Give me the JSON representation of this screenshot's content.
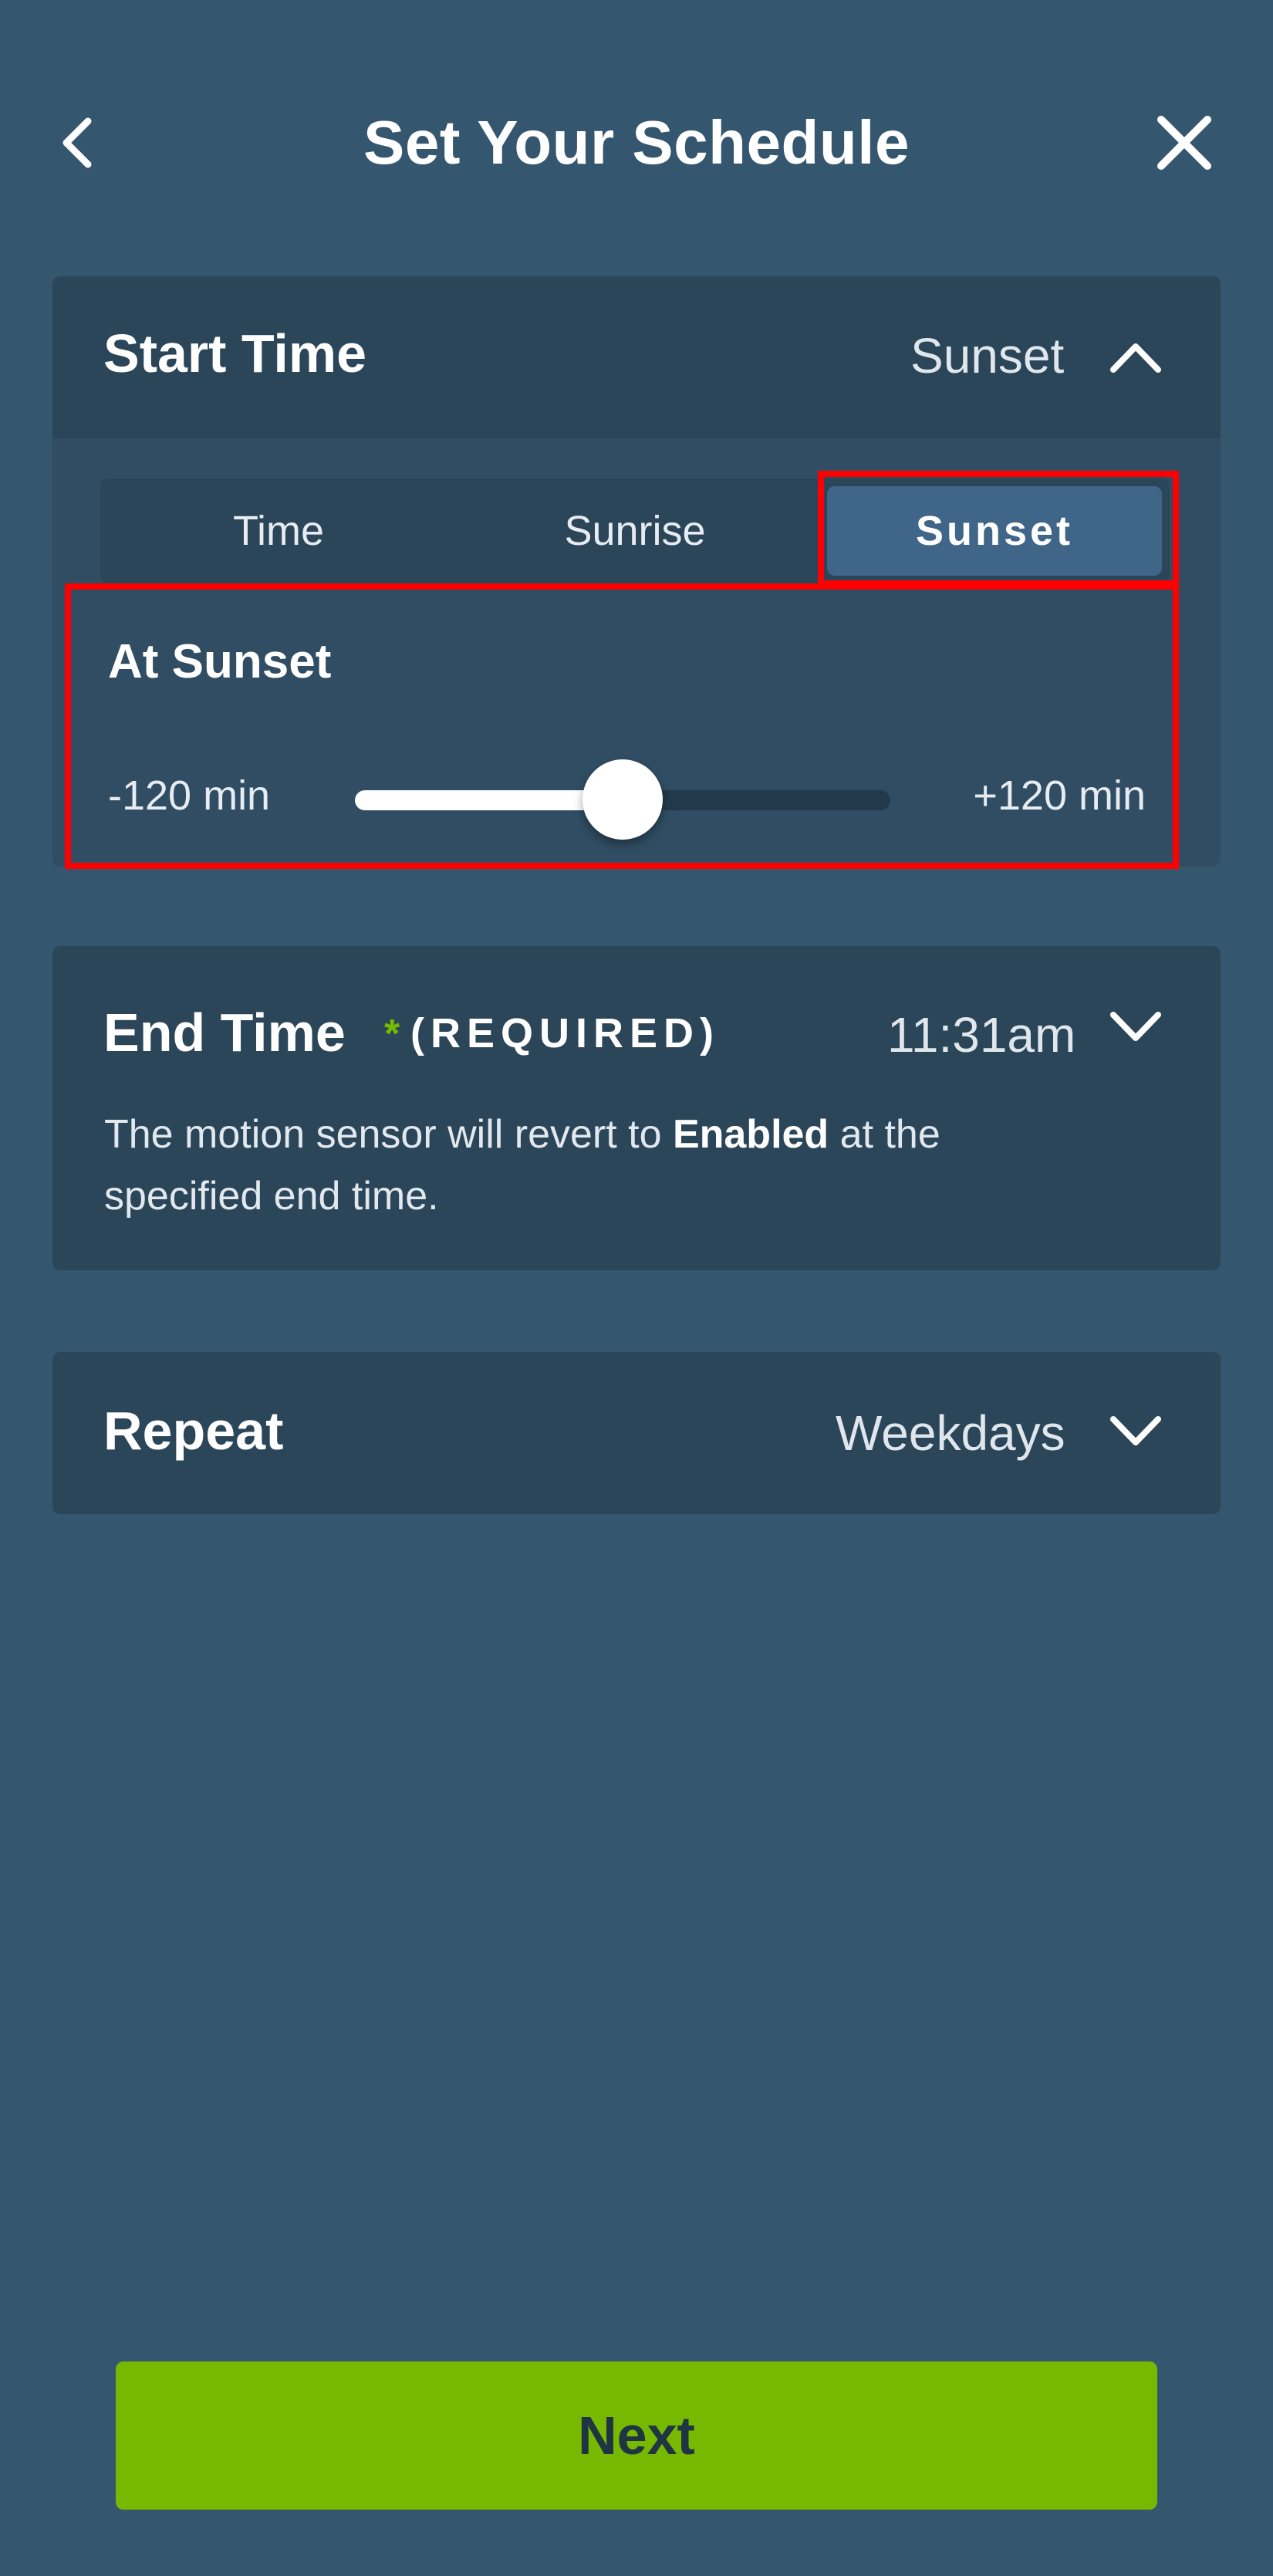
{
  "header": {
    "title": "Set Your Schedule",
    "back_icon": "chevron-left-icon",
    "close_icon": "close-icon"
  },
  "start_time": {
    "title": "Start Time",
    "value": "Sunset",
    "expanded": true,
    "tabs": [
      {
        "label": "Time",
        "selected": false
      },
      {
        "label": "Sunrise",
        "selected": false
      },
      {
        "label": "Sunset",
        "selected": true
      }
    ],
    "offset_label": "At Sunset",
    "slider": {
      "min_label": "-120 min",
      "max_label": "+120 min",
      "min": -120,
      "max": 120,
      "value": 0
    }
  },
  "end_time": {
    "title": "End Time",
    "required_star": "*",
    "required_label": "(REQUIRED)",
    "value": "11:31am",
    "desc_prefix": "The motion sensor will revert to ",
    "desc_emphasis": "Enabled",
    "desc_suffix": " at the specified end time."
  },
  "repeat": {
    "title": "Repeat",
    "value": "Weekdays"
  },
  "footer": {
    "next_label": "Next"
  },
  "colors": {
    "background": "#35566f",
    "panel": "#2b4559",
    "accent_green": "#77b900",
    "selected_tab": "#3f6688",
    "highlight": "#ff0000"
  }
}
